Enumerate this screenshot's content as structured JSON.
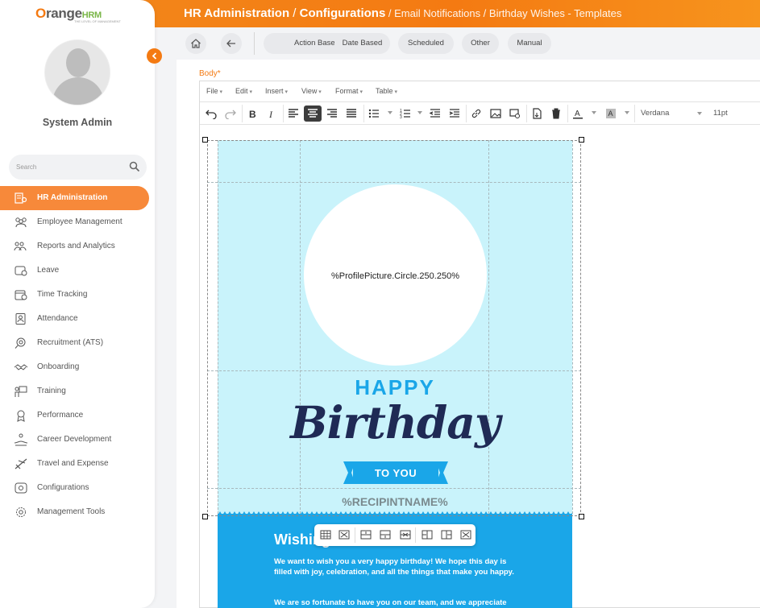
{
  "header": {
    "crumb_main": "HR Administration",
    "sep1": " / ",
    "crumb_config": "Configurations",
    "sep2": " / ",
    "crumb_rest": "Email Notifications / Birthday Wishes - Templates"
  },
  "sidebar": {
    "logo_main": "range",
    "logo_o": "O",
    "logo_hrm": "HRM",
    "logo_tagline": "THE LEVEL OF MANAGEMENT",
    "user_name": "System Admin",
    "search_placeholder": "Search",
    "items": [
      {
        "label": "HR Administration",
        "icon": "hr-admin-icon",
        "active": true
      },
      {
        "label": "Employee Management",
        "icon": "employees-icon"
      },
      {
        "label": "Reports and Analytics",
        "icon": "reports-icon"
      },
      {
        "label": "Leave",
        "icon": "leave-icon"
      },
      {
        "label": "Time Tracking",
        "icon": "time-icon"
      },
      {
        "label": "Attendance",
        "icon": "attendance-icon"
      },
      {
        "label": "Recruitment (ATS)",
        "icon": "recruitment-icon"
      },
      {
        "label": "Onboarding",
        "icon": "onboarding-icon"
      },
      {
        "label": "Training",
        "icon": "training-icon"
      },
      {
        "label": "Performance",
        "icon": "performance-icon"
      },
      {
        "label": "Career Development",
        "icon": "career-icon"
      },
      {
        "label": "Travel and Expense",
        "icon": "travel-icon"
      },
      {
        "label": "Configurations",
        "icon": "configurations-icon"
      },
      {
        "label": "Management Tools",
        "icon": "tools-icon"
      }
    ]
  },
  "toolbar": {
    "tabs": [
      "Action Based",
      "Date Based",
      "Scheduled",
      "Other",
      "Manual"
    ]
  },
  "editor": {
    "label": "Body",
    "required_mark": "*",
    "menus": [
      "File",
      "Edit",
      "Insert",
      "View",
      "Format",
      "Table"
    ],
    "font_family": "Verdana",
    "font_size": "11pt"
  },
  "template": {
    "profile_placeholder": "%ProfilePicture.Circle.250.250%",
    "happy": "HAPPY",
    "birthday": "Birthday",
    "to_you": "TO YOU",
    "recipient": "%RECIPINTNAME%",
    "wishing": "Wishing",
    "para1": "We want to wish you a very happy birthday! We hope this day is filled with joy, celebration, and all the things that make you happy.",
    "para2": "We are so fortunate to have you on our team, and we appreciate"
  },
  "colors": {
    "accent": "#f47a12",
    "canvas_bg": "#c9f3fb",
    "blue_band": "#1aa6e8",
    "happy_text": "#1aa6e8",
    "birthday_text": "#1f2a55"
  }
}
